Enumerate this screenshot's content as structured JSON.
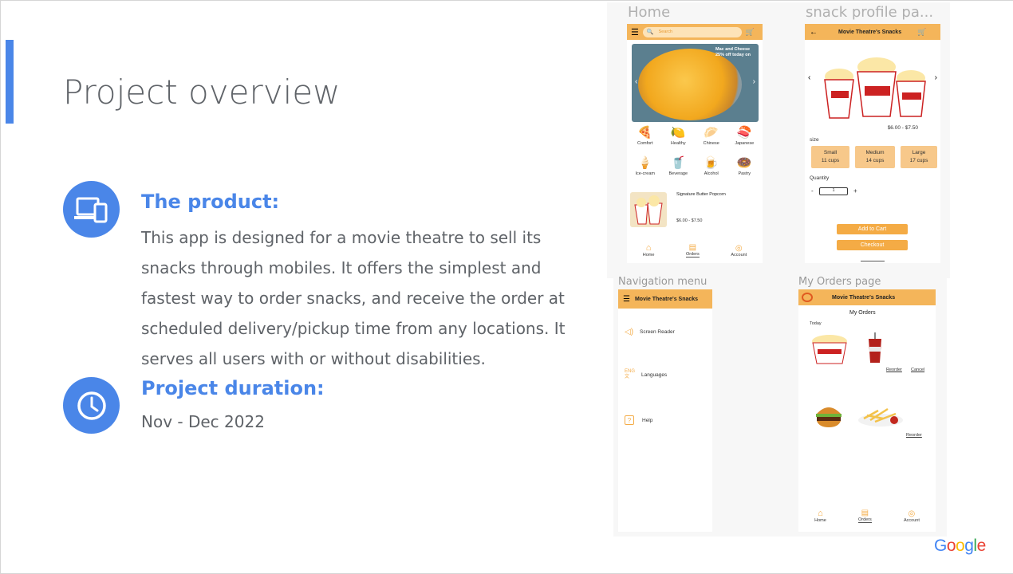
{
  "slide": {
    "title": "Project overview",
    "product_heading": "The product:",
    "product_text": "This app is designed for a movie theatre to sell its snacks through mobiles. It offers the simplest and fastest way to order snacks, and receive the order at scheduled delivery/pickup time from any locations. It serves all users with or without disabilities.",
    "duration_heading": "Project duration:",
    "duration_text": "Nov - Dec 2022",
    "accent_color": "#4a86e8",
    "brand": {
      "g1": "G",
      "o1": "o",
      "o2": "o",
      "g2": "g",
      "l": "l",
      "e": "e"
    }
  },
  "home_screen": {
    "label": "Home",
    "search_placeholder": "Search",
    "banner_text": "Mac and Cheese 25% off today on",
    "categories": [
      "Comfort",
      "Healthy",
      "Chinese",
      "Japanese",
      "Ice-cream",
      "Beverage",
      "Alcohol",
      "Pastry"
    ],
    "featured_name": "Signature Butter Popcorn",
    "featured_price": "$6.00 - $7.50",
    "nav": [
      "Home",
      "Orders",
      "Account"
    ]
  },
  "profile_screen": {
    "label": "snack profile pa...",
    "title": "Movie Theatre's Snacks",
    "price": "$6.00 - $7.50",
    "size_label": "size",
    "sizes": [
      {
        "name": "Small",
        "cups": "11 cups"
      },
      {
        "name": "Medium",
        "cups": "14 cups"
      },
      {
        "name": "Large",
        "cups": "17 cups"
      }
    ],
    "quantity_label": "Quantity",
    "quantity_value": "1",
    "minus": "-",
    "plus": "+",
    "add_to_cart": "Add to Cart",
    "checkout": "Checkout"
  },
  "nav_menu_screen": {
    "label": "Navigation menu",
    "title": "Movie Theatre's Snacks",
    "items": [
      "Screen Reader",
      "Languages",
      "Help"
    ],
    "lang_icon_text": "ENG\n文"
  },
  "orders_screen": {
    "label": "My Orders page",
    "title": "Movie Theatre's Snacks",
    "heading": "My Orders",
    "today": "Today",
    "reorder": "Reorder",
    "cancel": "Cancel",
    "reorder2": "Reorder",
    "nav": [
      "Home",
      "Orders",
      "Account"
    ]
  }
}
